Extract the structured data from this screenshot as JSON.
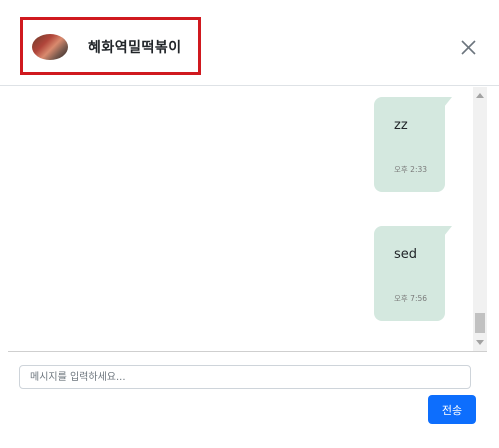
{
  "header": {
    "title": "혜화역밀떡볶이",
    "avatar_icon": "user-avatar-photo",
    "close_icon": "close-icon"
  },
  "messages": [
    {
      "text": "zz",
      "time": "오후 2:33"
    },
    {
      "text": "sed",
      "time": "오후 7:56"
    }
  ],
  "composer": {
    "placeholder": "메시지를 입력하세요...",
    "value": "",
    "send_label": "전송"
  },
  "colors": {
    "bubble": "#d4e8df",
    "send_button": "#0d6efd",
    "highlight": "#d0191f"
  }
}
